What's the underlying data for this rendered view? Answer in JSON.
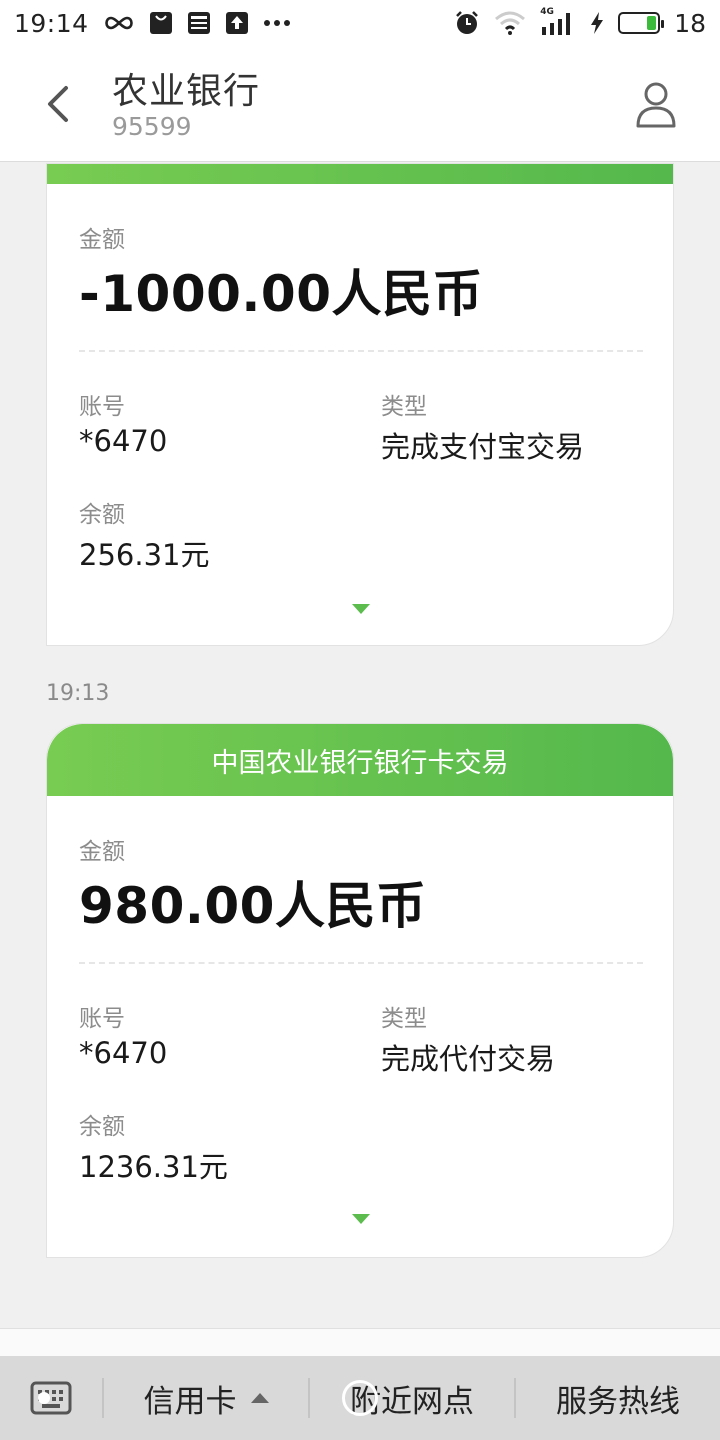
{
  "status_bar": {
    "time": "19:14",
    "network": "4G",
    "battery_level": "18"
  },
  "header": {
    "title": "农业银行",
    "subtitle": "95599"
  },
  "messages": [
    {
      "time": "",
      "header_title": "",
      "amount_label": "金额",
      "amount": "-1000.00人民币",
      "account_label": "账号",
      "account": "*6470",
      "type_label": "类型",
      "type": "完成支付宝交易",
      "balance_label": "余额",
      "balance": "256.31元"
    },
    {
      "time": "19:13",
      "header_title": "中国农业银行银行卡交易",
      "amount_label": "金额",
      "amount": "980.00人民币",
      "account_label": "账号",
      "account": "*6470",
      "type_label": "类型",
      "type": "完成代付交易",
      "balance_label": "余额",
      "balance": "1236.31元"
    }
  ],
  "bottom_menu": {
    "items": [
      {
        "label": "信用卡"
      },
      {
        "label": "附近网点"
      },
      {
        "label": "服务热线"
      }
    ]
  },
  "colors": {
    "accent_green": "#5cbc4e",
    "header_gradient_start": "#78cc52",
    "header_gradient_end": "#54b84c"
  }
}
